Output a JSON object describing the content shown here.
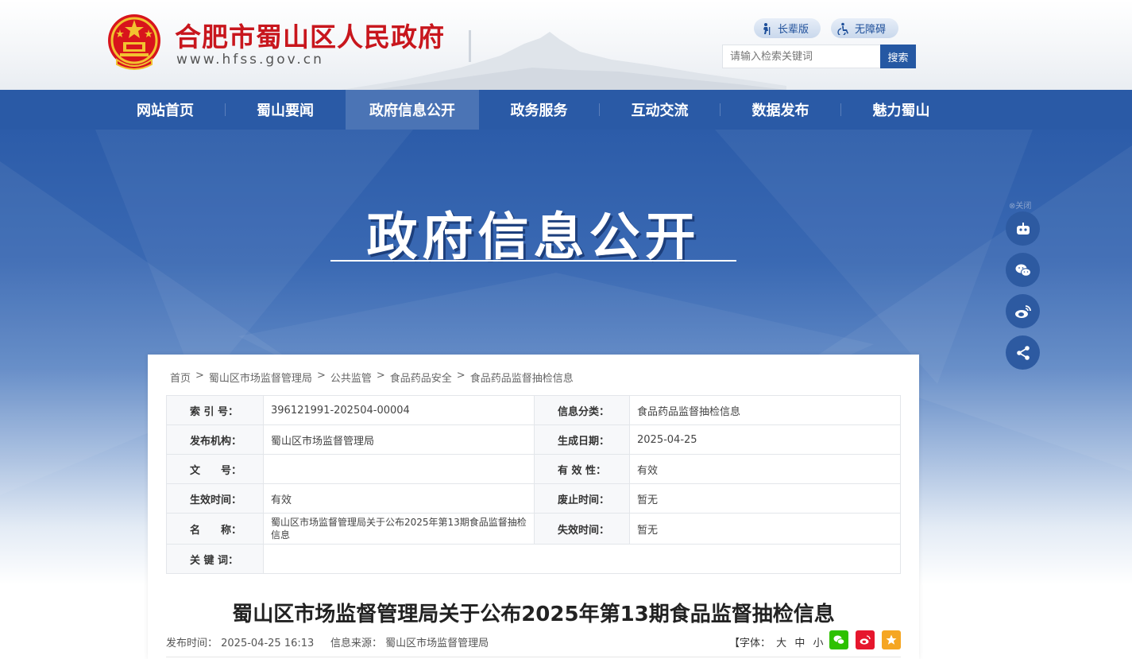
{
  "header": {
    "title": "合肥市蜀山区人民政府",
    "url": "www.hfss.gov.cn",
    "elder_label": "长辈版",
    "access_label": "无障碍",
    "search_placeholder": "请输入检索关键词",
    "search_button": "搜索"
  },
  "nav": {
    "items": [
      "网站首页",
      "蜀山要闻",
      "政府信息公开",
      "政务服务",
      "互动交流",
      "数据发布",
      "魅力蜀山"
    ],
    "active": "政府信息公开"
  },
  "banner": {
    "title": "政府信息公开"
  },
  "float": {
    "close_label": "⊗关闭"
  },
  "breadcrumb": [
    "首页",
    "蜀山区市场监督管理局",
    "公共监管",
    "食品药品安全",
    "食品药品监督抽检信息"
  ],
  "meta": {
    "index_label": "索 引 号：",
    "index_value": "396121991-202504-00004",
    "category_label": "信息分类：",
    "category_value": "食品药品监督抽检信息",
    "org_label": "发布机构：",
    "org_value": "蜀山区市场监督管理局",
    "date_label": "生成日期：",
    "date_value": "2025-04-25",
    "docno_label": "文　　号：",
    "docno_value": "",
    "validity_label": "有 效 性：",
    "validity_value": "有效",
    "effective_label": "生效时间：",
    "effective_value": "有效",
    "repeal_label": "废止时间：",
    "repeal_value": "暂无",
    "name_label": "名　　称：",
    "name_value": "蜀山区市场监督管理局关于公布2025年第13期食品监督抽检信息",
    "expire_label": "失效时间：",
    "expire_value": "暂无",
    "keywords_label": "关 键 词：",
    "keywords_value": ""
  },
  "article": {
    "title": "蜀山区市场监督管理局关于公布2025年第13期食品监督抽检信息",
    "publish_time": "发布时间： 2025-04-25 16:13",
    "source": "信息来源： 蜀山区市场监督管理局",
    "font_label": "【字体：",
    "font_large": "大",
    "font_medium": "中",
    "font_small": "小",
    "font_close": "】"
  },
  "colors": {
    "primary": "#2a5aa6",
    "title_red": "#c8161d",
    "wechat": "#2dc100",
    "weibo": "#e6162d",
    "fav": "#f5a623"
  }
}
